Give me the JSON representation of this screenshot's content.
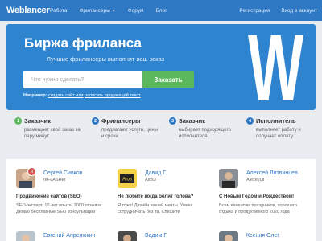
{
  "nav": {
    "logo": "Weblancer",
    "links": [
      "Работа",
      "Фрилансеры",
      "Форум",
      "Блог"
    ],
    "right": [
      "Регистрация",
      "Вход в аккаунт"
    ]
  },
  "hero": {
    "title": "Биржа фриланса",
    "subtitle": "Лучшие фрилансеры выполнят ваш заказ",
    "search_placeholder": "Что нужно сделать?",
    "search_button": "Заказать",
    "example_label": "Например:",
    "example_text": "создать сайт или",
    "example_link": "написать продающий текст",
    "big_letter": "W"
  },
  "steps": [
    {
      "num": "1",
      "title": "Заказчик",
      "text": "размещает свой заказ за пару минут"
    },
    {
      "num": "2",
      "title": "Фрилансеры",
      "text": "предлагают услуги, цены и сроки"
    },
    {
      "num": "3",
      "title": "Заказчик",
      "text": "выбирает подходящего исполнителя"
    },
    {
      "num": "4",
      "title": "Исполнитель",
      "text": "выполняет работу и получает оплату"
    }
  ],
  "cards": [
    {
      "name": "Сергей Сивков",
      "login": "reFLASHer",
      "badge": "R",
      "title": "Продвижение сайтов (SEO)",
      "desc": "SEO-эксперт, 10 лет опыта, 2000 отзывов. Делаю бесплатные SEO консультации"
    },
    {
      "name": "Давид Г.",
      "login": "Alos3",
      "badge": "",
      "title": "Не любите когда болит голова?",
      "desc": "Я тоже! Дизайн вашей мечты. Умею сотрудничать без та. Спешите"
    },
    {
      "name": "Алексей Литвинцев",
      "login": "AlexeyLit",
      "badge": "",
      "title": "С Новым Годом и Рождеством!",
      "desc": "Всем клиентам праздников, хорошего отдыха и продуктивного 2020 года"
    },
    {
      "name": "Евгений Апрелюкин",
      "login": "",
      "badge": "",
      "title": "",
      "desc": ""
    },
    {
      "name": "Вадим Г.",
      "login": "",
      "badge": "",
      "title": "",
      "desc": ""
    },
    {
      "name": "Ксения Олег",
      "login": "",
      "badge": "",
      "title": "",
      "desc": ""
    }
  ]
}
